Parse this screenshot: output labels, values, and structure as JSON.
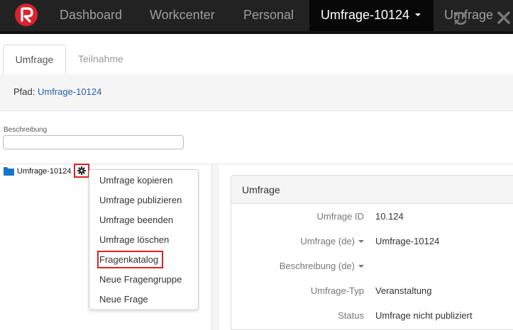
{
  "nav": {
    "items": [
      "Dashboard",
      "Workcenter",
      "Personal",
      "Umfrage-10124",
      "Umfrage"
    ],
    "active_index": 3
  },
  "tabs": [
    "Umfrage",
    "Teilnahme"
  ],
  "path": {
    "label": "Pfad:",
    "link": "Umfrage-10124"
  },
  "description": {
    "label": "Beschreibung",
    "value": ""
  },
  "tree": {
    "root_label": "Umfrage-10124",
    "menu_items": [
      "Umfrage kopieren",
      "Umfrage publizieren",
      "Umfrage beenden",
      "Umfrage löschen",
      "Fragenkatalog",
      "Neue Fragengruppe",
      "Neue Frage"
    ],
    "highlighted_item": "Fragenkatalog"
  },
  "panel": {
    "title": "Umfrage",
    "fields": [
      {
        "label": "Umfrage ID",
        "value": "10.124",
        "dropdown": false
      },
      {
        "label": "Umfrage (de)",
        "value": "Umfrage-10124",
        "dropdown": true
      },
      {
        "label": "Beschreibung (de)",
        "value": "",
        "dropdown": true
      },
      {
        "label": "Umfrage-Typ",
        "value": "Veranstaltung",
        "dropdown": false
      },
      {
        "label": "Status",
        "value": "Umfrage nicht publiziert",
        "dropdown": false
      }
    ]
  },
  "colors": {
    "accent_red": "#e31e24",
    "link_blue": "#2a5db0",
    "nav_bg": "#222222"
  }
}
